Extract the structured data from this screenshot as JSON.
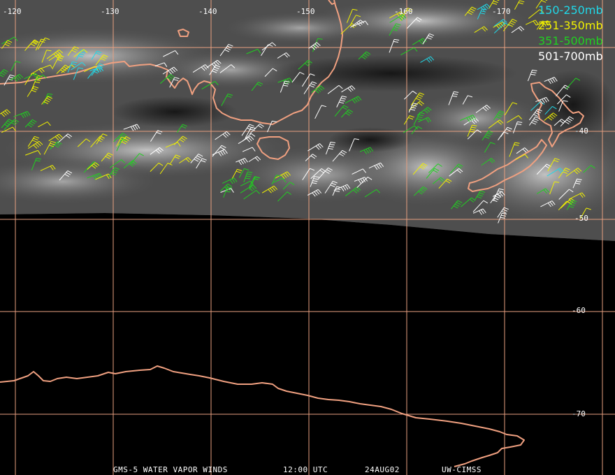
{
  "map": {
    "longitude_labels": [
      "-120",
      "-130",
      "-140",
      "-150",
      "-160",
      "-170"
    ],
    "latitude_labels": [
      "-40",
      "-50",
      "-60",
      "-70"
    ],
    "colors": {
      "coastline": "#f0a080",
      "gridlines": "#e8a080",
      "band_150_250": "#20d8e8",
      "band_251_350": "#f0f000",
      "band_351_500": "#20d020",
      "band_501_700": "#ffffff"
    }
  },
  "legend": [
    {
      "label": "150-250mb",
      "color": "#20d8e8"
    },
    {
      "label": "251-350mb",
      "color": "#f0f000"
    },
    {
      "label": "351-500mb",
      "color": "#20d020"
    },
    {
      "label": "501-700mb",
      "color": "#ffffff"
    }
  ],
  "footer": {
    "product": "GMS-5 WATER VAPOR WINDS",
    "time": "12:00 UTC",
    "date": "24AUG02",
    "source": "UW-CIMSS"
  }
}
